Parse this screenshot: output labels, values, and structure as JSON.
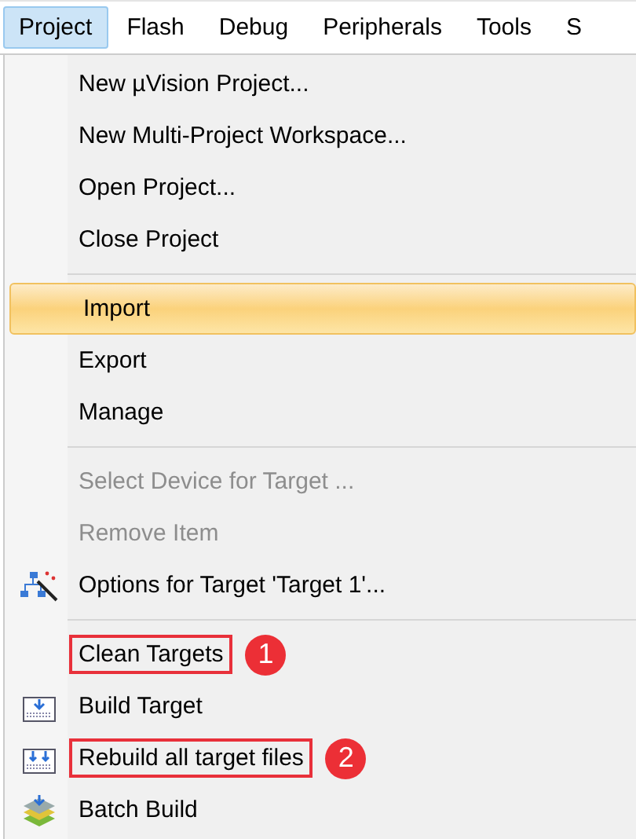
{
  "menu_bar": [
    {
      "label": "Project",
      "selected": true
    },
    {
      "label": "Flash",
      "selected": false
    },
    {
      "label": "Debug",
      "selected": false
    },
    {
      "label": "Peripherals",
      "selected": false
    },
    {
      "label": "Tools",
      "selected": false
    },
    {
      "label": "S",
      "selected": false
    }
  ],
  "menu": [
    {
      "kind": "item",
      "label": "New µVision Project...",
      "disabled": false,
      "selected": false
    },
    {
      "kind": "item",
      "label": "New Multi-Project Workspace...",
      "disabled": false,
      "selected": false
    },
    {
      "kind": "item",
      "label": "Open Project...",
      "disabled": false,
      "selected": false
    },
    {
      "kind": "item",
      "label": "Close Project",
      "disabled": false,
      "selected": false
    },
    {
      "kind": "separator"
    },
    {
      "kind": "item",
      "label": "Import",
      "disabled": false,
      "selected": true
    },
    {
      "kind": "item",
      "label": "Export",
      "disabled": false,
      "selected": false
    },
    {
      "kind": "item",
      "label": "Manage",
      "disabled": false,
      "selected": false
    },
    {
      "kind": "separator"
    },
    {
      "kind": "item",
      "label": "Select Device for Target ...",
      "disabled": true,
      "selected": false
    },
    {
      "kind": "item",
      "label": "Remove Item",
      "disabled": true,
      "selected": false
    },
    {
      "kind": "options",
      "label": "Options for Target 'Target 1'...",
      "disabled": false,
      "selected": false
    },
    {
      "kind": "separator"
    },
    {
      "kind": "item",
      "label": "Clean Targets",
      "disabled": false,
      "selected": false,
      "callout": "1"
    },
    {
      "kind": "build",
      "label": "Build Target",
      "disabled": false,
      "selected": false
    },
    {
      "kind": "rebuild",
      "label": "Rebuild all target files",
      "disabled": false,
      "selected": false,
      "callout": "2"
    },
    {
      "kind": "batch",
      "label": "Batch Build",
      "disabled": false,
      "selected": false
    }
  ]
}
